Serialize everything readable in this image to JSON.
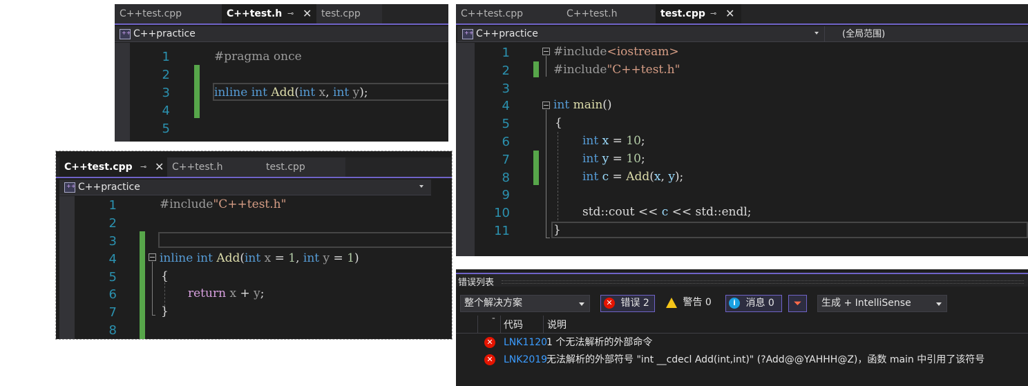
{
  "header_panel": {
    "tabs": [
      {
        "label": "C++test.cpp",
        "active": false
      },
      {
        "label": "C++test.h",
        "active": true
      },
      {
        "label": "test.cpp",
        "active": false
      }
    ],
    "project": "C++practice",
    "line_numbers": [
      "1",
      "2",
      "3",
      "4",
      "5"
    ],
    "code_lines": [
      "#pragma once",
      "",
      "inline int Add(int x, int y);",
      "",
      ""
    ]
  },
  "source_panel": {
    "tabs": [
      {
        "label": "C++test.cpp",
        "active": true
      },
      {
        "label": "C++test.h",
        "active": false
      },
      {
        "label": "test.cpp",
        "active": false
      }
    ],
    "project": "C++practice",
    "line_numbers": [
      "1",
      "2",
      "3",
      "4",
      "5",
      "6",
      "7",
      "8"
    ],
    "code_lines": [
      "#include\"C++test.h\"",
      "",
      "",
      "inline int Add(int x = 1, int y = 1)",
      "{",
      "return x + y;",
      "}",
      ""
    ]
  },
  "main_panel": {
    "tabs": [
      {
        "label": "C++test.cpp",
        "active": false
      },
      {
        "label": "C++test.h",
        "active": false
      },
      {
        "label": "test.cpp",
        "active": true
      }
    ],
    "project": "C++practice",
    "scope": "(全局范围)",
    "line_numbers": [
      "1",
      "2",
      "3",
      "4",
      "5",
      "6",
      "7",
      "8",
      "9",
      "10",
      "11"
    ],
    "code_lines": [
      "#include<iostream>",
      "#include\"C++test.h\"",
      "",
      "int main()",
      "{",
      "int x = 10;",
      "int y = 10;",
      "int c = Add(x, y);",
      "",
      "std::cout << c << std::endl;",
      "}"
    ]
  },
  "error_list": {
    "title": "错误列表",
    "scope_filter": "整个解决方案",
    "errors_label": "错误 2",
    "warnings_label": "警告 0",
    "messages_label": "消息 0",
    "build_filter": "生成 + IntelliSense",
    "columns": {
      "code": "代码",
      "description": "说明"
    },
    "rows": [
      {
        "code": "LNK1120",
        "description": "1 个无法解析的外部命令"
      },
      {
        "code": "LNK2019",
        "description": "无法解析的外部符号 \"int __cdecl Add(int,int)\" (?Add@@YAHHH@Z)，函数 main 中引用了该符号"
      }
    ]
  },
  "colors": {
    "editor_bg": "#1e1e1e",
    "accent": "#6f63c8",
    "keyword": "#569cd6",
    "function": "#dcdcaa",
    "string": "#d69d85",
    "line_number": "#2b91af",
    "change_bar": "#57a64a",
    "error_red": "#e51400",
    "link_blue": "#3b9cff"
  }
}
